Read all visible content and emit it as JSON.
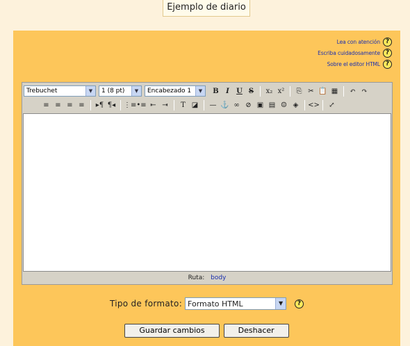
{
  "page_title": "Ejemplo de diario",
  "help_links": [
    {
      "label": "Lea con atención"
    },
    {
      "label": "Escriba cuidadosamente"
    },
    {
      "label": "Sobre el editor HTML"
    }
  ],
  "help_icon_glyph": "?",
  "toolbar": {
    "font_select": "Trebuchet",
    "size_select": "1 (8 pt)",
    "heading_select": "Encabezado 1",
    "row1_buttons": [
      {
        "icon": "bold-icon",
        "glyph": "B"
      },
      {
        "icon": "italic-icon",
        "glyph": "I"
      },
      {
        "icon": "underline-icon",
        "glyph": "U"
      },
      {
        "icon": "strikethrough-icon",
        "glyph": "S"
      },
      {
        "icon": "subscript-icon",
        "glyph": "x₂"
      },
      {
        "icon": "superscript-icon",
        "glyph": "x²"
      },
      {
        "icon": "copy-icon",
        "glyph": "⎘"
      },
      {
        "icon": "cut-icon",
        "glyph": "✂"
      },
      {
        "icon": "paste-icon",
        "glyph": "📋"
      },
      {
        "icon": "clean-word-icon",
        "glyph": "▦"
      },
      {
        "icon": "undo-icon",
        "glyph": "↶"
      },
      {
        "icon": "redo-icon",
        "glyph": "↷"
      }
    ],
    "row2_buttons": [
      {
        "icon": "align-left-icon",
        "glyph": "≡"
      },
      {
        "icon": "align-center-icon",
        "glyph": "≡"
      },
      {
        "icon": "align-right-icon",
        "glyph": "≡"
      },
      {
        "icon": "justify-icon",
        "glyph": "≡"
      },
      {
        "icon": "ltr-icon",
        "glyph": "▸¶"
      },
      {
        "icon": "rtl-icon",
        "glyph": "¶◂"
      },
      {
        "icon": "ordered-list-icon",
        "glyph": "⋮≡"
      },
      {
        "icon": "unordered-list-icon",
        "glyph": "•≡"
      },
      {
        "icon": "outdent-icon",
        "glyph": "⇤"
      },
      {
        "icon": "indent-icon",
        "glyph": "⇥"
      },
      {
        "icon": "text-color-icon",
        "glyph": "T"
      },
      {
        "icon": "bg-color-icon",
        "glyph": "◪"
      },
      {
        "icon": "horizontal-rule-icon",
        "glyph": "—"
      },
      {
        "icon": "anchor-icon",
        "glyph": "⚓"
      },
      {
        "icon": "link-icon",
        "glyph": "∞"
      },
      {
        "icon": "unlink-icon",
        "glyph": "⊘"
      },
      {
        "icon": "image-icon",
        "glyph": "▣"
      },
      {
        "icon": "table-icon",
        "glyph": "▤"
      },
      {
        "icon": "smiley-icon",
        "glyph": "☺"
      },
      {
        "icon": "special-char-icon",
        "glyph": "◈"
      },
      {
        "icon": "html-source-icon",
        "glyph": "<>"
      },
      {
        "icon": "fullscreen-icon",
        "glyph": "⤢"
      }
    ]
  },
  "path_bar": {
    "label": "Ruta:",
    "element": "body"
  },
  "format": {
    "label": "Tipo de formato:",
    "value": "Formato HTML"
  },
  "buttons": {
    "save": "Guardar cambios",
    "undo": "Deshacer"
  },
  "colors": {
    "panel": "#fdc65a",
    "background": "#fdf2dc",
    "link": "#1a2fb0"
  }
}
